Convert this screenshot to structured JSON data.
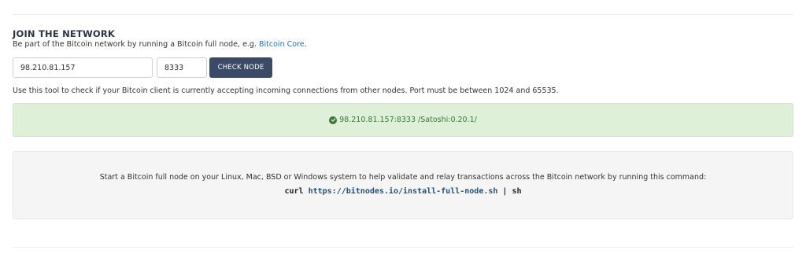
{
  "section": {
    "title": "JOIN THE NETWORK",
    "subtitle_prefix": "Be part of the Bitcoin network by running a Bitcoin full node, e.g. ",
    "subtitle_link": "Bitcoin Core",
    "subtitle_suffix": "."
  },
  "form": {
    "ip_value": "98.210.81.157",
    "port_value": "8333",
    "check_button_label": "CHECK NODE"
  },
  "help_text": "Use this tool to check if your Bitcoin client is currently accepting incoming connections from other nodes. Port must be between 1024 and 65535.",
  "result": {
    "icon": "check-circle-icon",
    "text": "98.210.81.157:8333 /Satoshi:0.20.1/",
    "color": "#3c763d",
    "background": "#dff0d8"
  },
  "install": {
    "description": "Start a Bitcoin full node on your Linux, Mac, BSD or Windows system to help validate and relay transactions across the Bitcoin network by running this command:",
    "cmd_prefix": "curl ",
    "cmd_url": "https://bitnodes.io/install-full-node.sh",
    "cmd_suffix": " | sh"
  },
  "colors": {
    "button": "#3b4a66",
    "link": "#2a6fb5"
  }
}
